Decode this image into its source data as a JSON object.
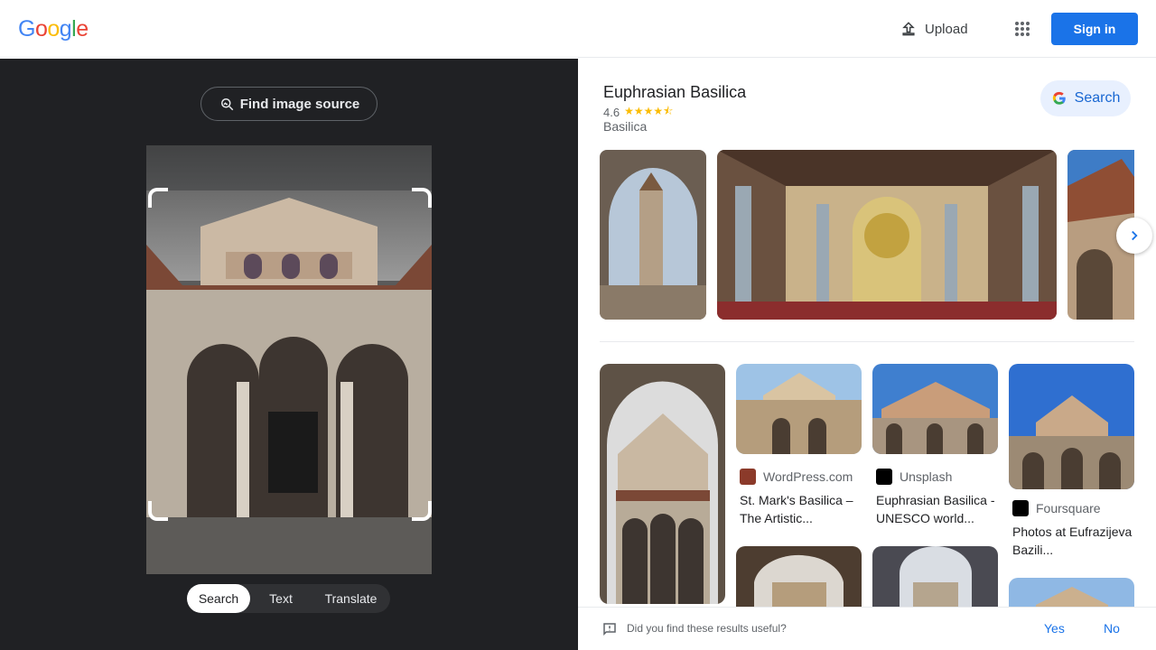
{
  "header": {
    "logo": [
      "G",
      "o",
      "o",
      "g",
      "l",
      "e"
    ],
    "upload_label": "Upload",
    "signin_label": "Sign in"
  },
  "left": {
    "find_source_label": "Find image source",
    "tabs": [
      "Search",
      "Text",
      "Translate"
    ],
    "active_tab": "Search"
  },
  "entity": {
    "title": "Euphrasian Basilica",
    "rating": "4.6",
    "stars": "★★★★⯪",
    "type": "Basilica",
    "search_label": "Search"
  },
  "results": [
    {
      "source": "WordPress.com",
      "title": "St. Mark's Basilica – The Artistic..."
    },
    {
      "source": "Unsplash",
      "title": "Euphrasian Basilica - UNESCO world..."
    },
    {
      "source": "Foursquare",
      "title": "Photos at Eufrazijeva Bazili..."
    }
  ],
  "feedback": {
    "question": "Did you find these results useful?",
    "yes": "Yes",
    "no": "No"
  },
  "colors": {
    "brand_blue": "#1a73e8",
    "dark_bg": "#202124"
  }
}
